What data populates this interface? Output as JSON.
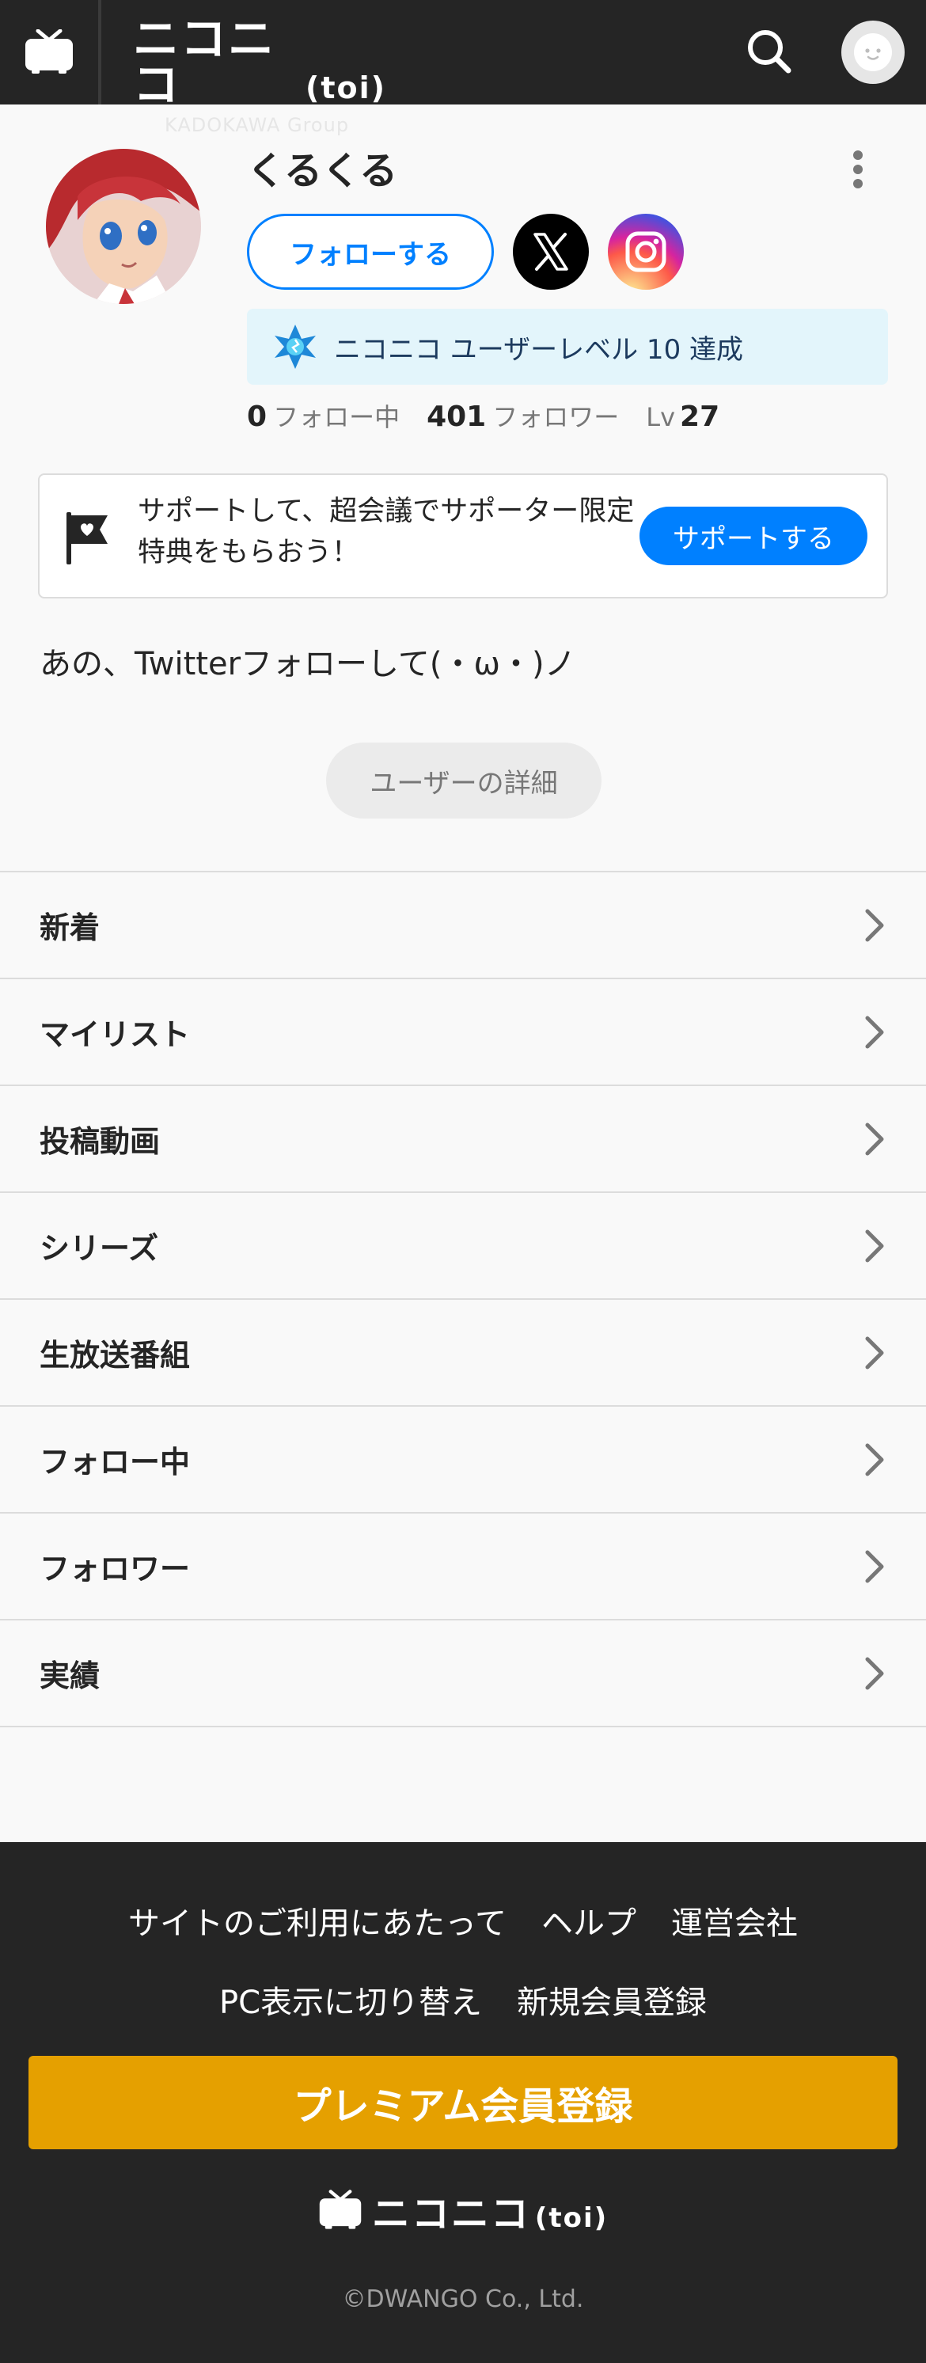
{
  "header": {
    "logo_text": "ニコニコ",
    "logo_suffix": "(toi)",
    "logo_sub": "KADOKAWA Group"
  },
  "profile": {
    "name": "くるくる",
    "follow_label": "フォローする",
    "level_banner": "ニコニコ ユーザーレベル 10 達成",
    "stats": {
      "following_count": "0",
      "following_label": "フォロー中",
      "followers_count": "401",
      "followers_label": "フォロワー",
      "level_prefix": "Lv",
      "level_value": "27"
    }
  },
  "support": {
    "text": "サポートして、超会議でサポーター限定特典をもらおう！",
    "button": "サポートする"
  },
  "bio": "あの、Twitterフォローして(・ω・)ノ",
  "details_button": "ユーザーの詳細",
  "menu": {
    "items": [
      {
        "label": "新着"
      },
      {
        "label": "マイリスト"
      },
      {
        "label": "投稿動画"
      },
      {
        "label": "シリーズ"
      },
      {
        "label": "生放送番組"
      },
      {
        "label": "フォロー中"
      },
      {
        "label": "フォロワー"
      },
      {
        "label": "実績"
      }
    ]
  },
  "footer": {
    "link_terms": "サイトのご利用にあたって",
    "link_help": "ヘルプ",
    "link_company": "運営会社",
    "link_pc": "PC表示に切り替え",
    "link_register": "新規会員登録",
    "premium": "プレミアム会員登録",
    "logo_text": "ニコニコ",
    "logo_suffix": "(toi)",
    "copyright": "©DWANGO Co., Ltd."
  },
  "colors": {
    "header_bg": "#252525",
    "accent_blue": "#0080ff",
    "premium_gold": "#e5a000",
    "level_banner_bg": "#e3f5fb"
  }
}
